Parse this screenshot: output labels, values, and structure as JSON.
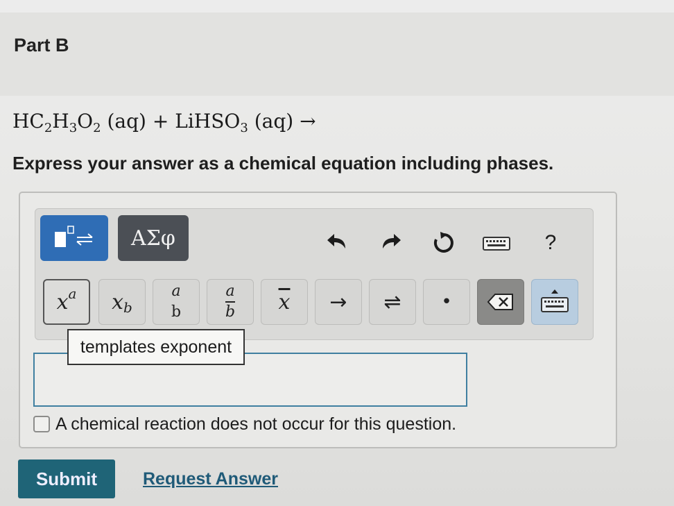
{
  "part": {
    "title": "Part B"
  },
  "question": {
    "equation_parts": [
      "HC",
      "2",
      "H",
      "3",
      "O",
      "2",
      "(aq) + LiHSO",
      "3",
      "(aq) →"
    ],
    "instruction": "Express your answer as a chemical equation including phases."
  },
  "toolbar": {
    "greek_label": "ΑΣφ",
    "help_label": "?",
    "keys": {
      "superscript": {
        "base": "x",
        "script": "a"
      },
      "subscript": {
        "base": "x",
        "script": "b"
      },
      "fraction": {
        "num": "a",
        "den": "b"
      },
      "fraction_bar": {
        "num": "a",
        "den": "b"
      },
      "overline": "x",
      "reaction_arrow": "→",
      "equilibrium_arrow": "⇌",
      "dot": "•"
    },
    "tooltip": "templates exponent"
  },
  "answer": {
    "input_value": "",
    "no_reaction_label": "A chemical reaction does not occur for this question.",
    "no_reaction_checked": false
  },
  "actions": {
    "submit_label": "Submit",
    "request_answer_label": "Request Answer"
  },
  "colors": {
    "templates_button": "#2f6db5",
    "greek_button": "#4b4f55",
    "submit_button": "#1f6477",
    "link": "#1f5a78",
    "input_border": "#3f7fa0"
  }
}
